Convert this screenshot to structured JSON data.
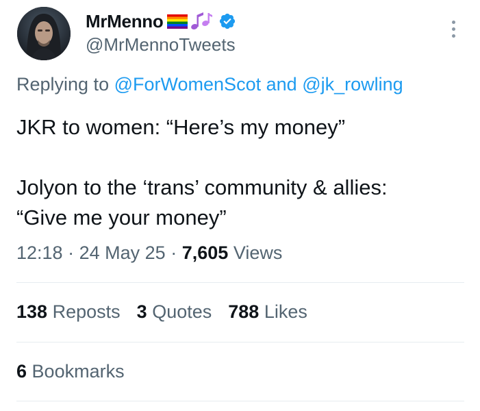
{
  "author": {
    "display_name": "MrMenno",
    "handle": "@MrMennoTweets",
    "name_emoji": [
      "rainbow-flag-emoji",
      "musical-notes-emoji"
    ],
    "verified": true
  },
  "reply": {
    "prefix": "Replying to",
    "mention_1": "@ForWomenScot",
    "joiner": "and",
    "mention_2": "@jk_rowling"
  },
  "tweet": {
    "paragraph_1": "JKR to women: “Here’s my money”",
    "paragraph_2_line_1": "Jolyon to the ‘trans’ community & allies:",
    "paragraph_2_line_2": "“Give me your money”"
  },
  "meta": {
    "time": "12:18",
    "separator": "·",
    "date": "24 May 25",
    "views_count": "7,605",
    "views_label": "Views"
  },
  "stats": {
    "reposts_count": "138",
    "reposts_label": "Reposts",
    "quotes_count": "3",
    "quotes_label": "Quotes",
    "likes_count": "788",
    "likes_label": "Likes"
  },
  "bookmarks": {
    "count": "6",
    "label": "Bookmarks"
  },
  "colors": {
    "text": "#0f1419",
    "secondary": "#536471",
    "link": "#1d9bf0",
    "divider": "#e6ecf0"
  }
}
